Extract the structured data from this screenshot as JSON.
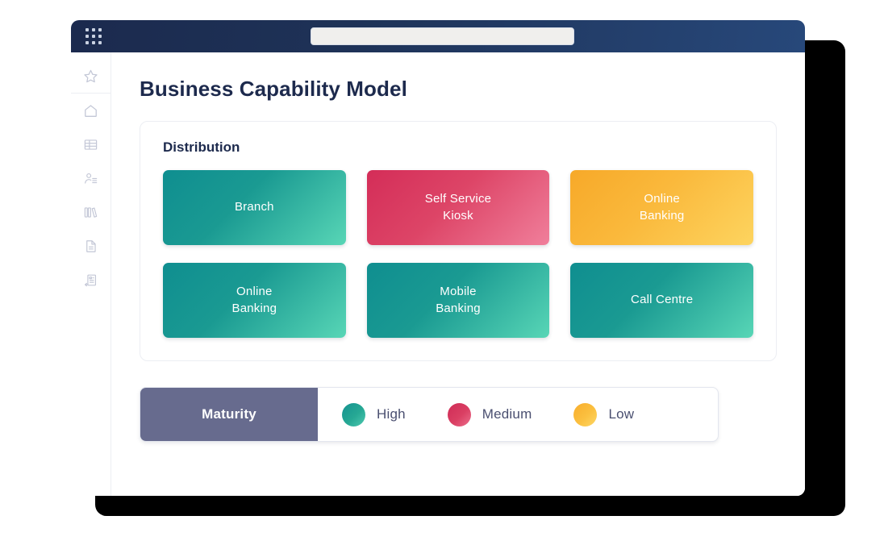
{
  "browser": {
    "app_launcher_icon": "app-grid-icon",
    "url_value": "",
    "url_placeholder": ""
  },
  "sidebar": {
    "items": [
      {
        "icon": "star-icon",
        "name": "favorites"
      },
      {
        "icon": "home-icon",
        "name": "home"
      },
      {
        "icon": "table-icon",
        "name": "tables"
      },
      {
        "icon": "contacts-icon",
        "name": "contacts"
      },
      {
        "icon": "books-icon",
        "name": "library"
      },
      {
        "icon": "document-icon",
        "name": "documents"
      },
      {
        "icon": "document-import-icon",
        "name": "imports"
      }
    ]
  },
  "page": {
    "title": "Business Capability Model"
  },
  "card": {
    "title": "Distribution",
    "tiles": [
      {
        "label": "Branch",
        "maturity": "High",
        "color": "teal"
      },
      {
        "label": "Self Service\nKiosk",
        "maturity": "Medium",
        "color": "pink"
      },
      {
        "label": "Online\nBanking",
        "maturity": "Low",
        "color": "yellow"
      },
      {
        "label": "Online\nBanking",
        "maturity": "High",
        "color": "teal"
      },
      {
        "label": "Mobile\nBanking",
        "maturity": "High",
        "color": "teal"
      },
      {
        "label": "Call Centre",
        "maturity": "High",
        "color": "teal"
      }
    ]
  },
  "legend": {
    "label": "Maturity",
    "items": [
      {
        "label": "High",
        "color": "#1a9a92",
        "swatch": "teal"
      },
      {
        "label": "Medium",
        "color": "#da3f63",
        "swatch": "pink"
      },
      {
        "label": "Low",
        "color": "#fbc040",
        "swatch": "yellow"
      }
    ]
  },
  "colors": {
    "titlebar_dark": "#1b2a4e",
    "titlebar_light": "#27487a",
    "title_text": "#1d2a4d",
    "legend_label_bg": "#676b8e",
    "high": "#1a9a92",
    "medium": "#da3f63",
    "low": "#fbc040"
  }
}
